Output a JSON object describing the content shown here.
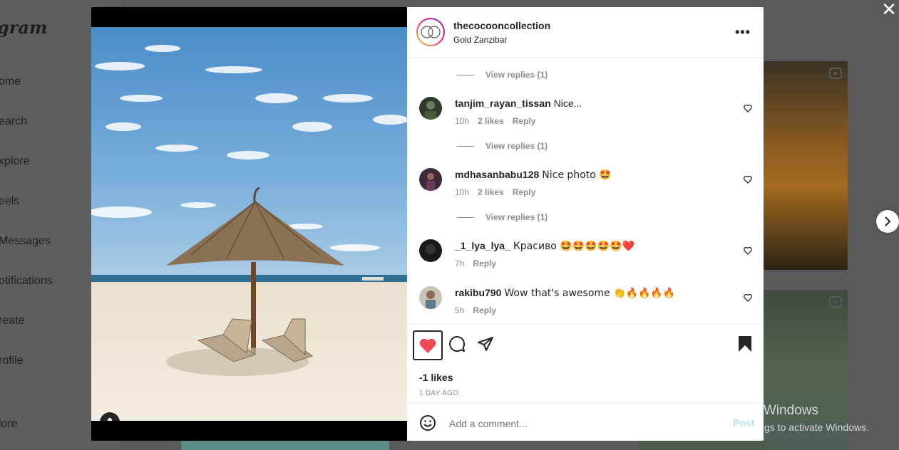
{
  "background": {
    "logo": "gram",
    "nav": [
      "ome",
      "earch",
      "xplore",
      "eels",
      "Messages",
      "otifications",
      "reate",
      "rofile",
      "lore"
    ]
  },
  "post": {
    "username": "thecocooncollection",
    "location": "Gold Zanzibar",
    "likes": "-1 likes",
    "time": "1 DAY AGO"
  },
  "comments": [
    {
      "user": "tanjim_rayan_tissan",
      "text": "Nice...",
      "time": "10h",
      "likes": "2 likes",
      "reply": "Reply"
    },
    {
      "user": "mdhasanbabu128",
      "text": "Nice photo 🤩",
      "time": "10h",
      "likes": "2 likes",
      "reply": "Reply"
    },
    {
      "user": "_1_lya_lya_",
      "text": "Красиво 🤩🤩🤩🤩🤩❤️",
      "time": "7h",
      "likes": "",
      "reply": "Reply"
    },
    {
      "user": "rakibu790",
      "text": "Wow that's awesome 👏🔥🔥🔥🔥",
      "time": "5h",
      "likes": "",
      "reply": "Reply"
    }
  ],
  "view_replies": [
    "View replies (1)",
    "View replies (1)",
    "View replies (1)"
  ],
  "add_comment": {
    "placeholder": "Add a comment...",
    "post_label": "Post"
  },
  "watermark": {
    "line1": "Activate Windows",
    "line2": "Go to Settings to activate Windows."
  },
  "colors": {
    "like": "#ed4956",
    "link": "#0095f6"
  }
}
